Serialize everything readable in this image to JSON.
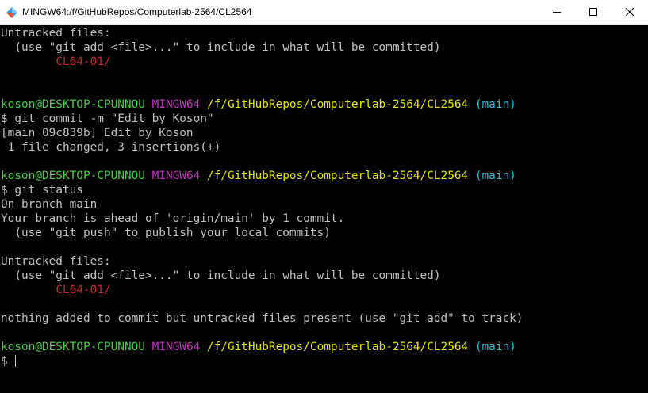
{
  "window": {
    "title": "MINGW64:/f/GitHubRepos/Computerlab-2564/CL2564",
    "icon": "git-bash-diamond-icon",
    "accent_colors": {
      "prompt_user": "#3fd13f",
      "prompt_env": "#c535c5",
      "prompt_path": "#e5e500",
      "prompt_branch": "#22bfd6",
      "untracked_file": "#d12020",
      "text": "#c0c0c0",
      "background": "#000000"
    }
  },
  "terminal": {
    "prompt": {
      "user_host": "koson@DESKTOP-CPUNNOU",
      "env": "MINGW64",
      "path": "/f/GitHubRepos/Computerlab-2564/CL2564",
      "branch": "(main)",
      "symbol": "$"
    },
    "lines": {
      "l1": "Untracked files:",
      "l2": "  (use \"git add <file>...\" to include in what will be committed)",
      "l3": "        CL64-01/",
      "l6_cmd": " git commit -m \"Edit by Koson\"",
      "l7": "[main 09c839b] Edit by Koson",
      "l8": " 1 file changed, 3 insertions(+)",
      "l11_cmd": " git status",
      "l12": "On branch main",
      "l13": "Your branch is ahead of 'origin/main' by 1 commit.",
      "l14": "  (use \"git push\" to publish your local commits)",
      "l16": "Untracked files:",
      "l17": "  (use \"git add <file>...\" to include in what will be committed)",
      "l18": "        CL64-01/",
      "l20": "nothing added to commit but untracked files present (use \"git add\" to track)",
      "l23_cmd": " "
    }
  }
}
